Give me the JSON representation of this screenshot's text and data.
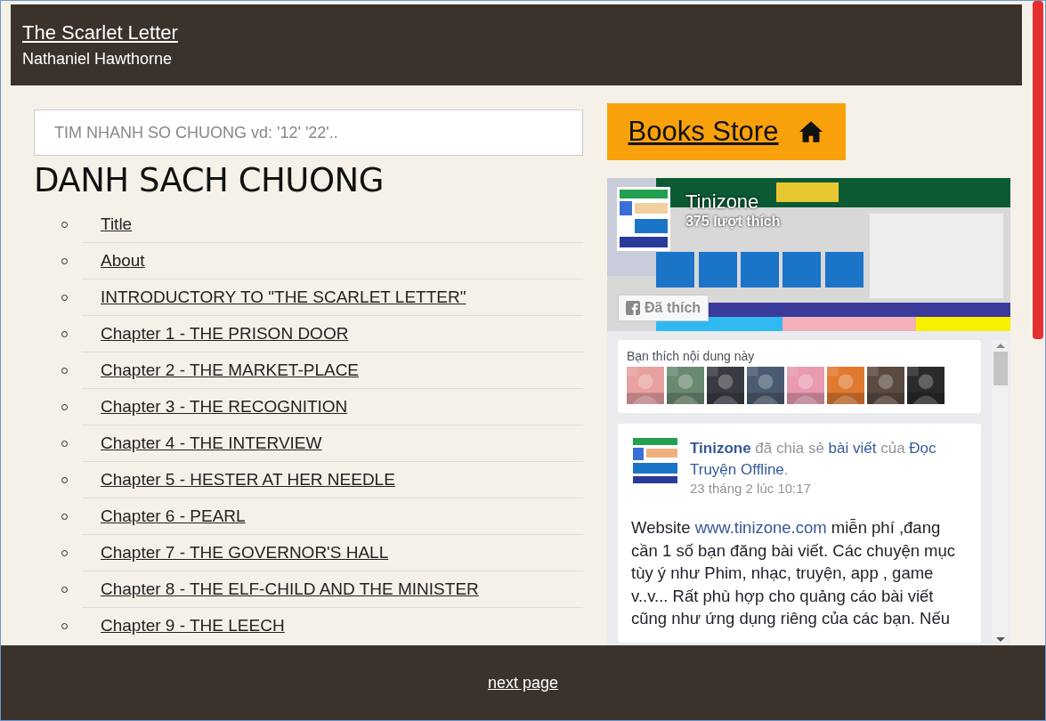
{
  "header": {
    "title": "The Scarlet Letter",
    "author": "Nathaniel Hawthorne"
  },
  "search": {
    "placeholder": "TIM NHANH SO CHUONG vd: '12' '22'.."
  },
  "heading": "DANH SACH CHUONG",
  "chapters": [
    "Title",
    "About",
    "INTRODUCTORY TO \"THE SCARLET LETTER\"",
    "Chapter 1 - THE PRISON DOOR",
    "Chapter 2 - THE MARKET-PLACE",
    "Chapter 3 - THE RECOGNITION",
    "Chapter 4 - THE INTERVIEW",
    "Chapter 5 - HESTER AT HER NEEDLE",
    "Chapter 6 - PEARL",
    "Chapter 7 - THE GOVERNOR'S HALL",
    "Chapter 8 - THE ELF-CHILD AND THE MINISTER",
    "Chapter 9 - THE LEECH"
  ],
  "store_button": {
    "label": "Books Store"
  },
  "facebook": {
    "page_name": "Tinizone",
    "likes": "375 lượt thích",
    "like_button": "Đã thích",
    "liked": true,
    "friends_title": "Bạn thích nội dung này",
    "friend_avatars": [
      {
        "color": "#e8a0a0"
      },
      {
        "color": "#6a8a70"
      },
      {
        "color": "#3a3a44"
      },
      {
        "color": "#4a5a70"
      },
      {
        "color": "#e89ab0"
      },
      {
        "color": "#e07a30"
      },
      {
        "color": "#5a4a40"
      },
      {
        "color": "#2a2a2a"
      }
    ],
    "post": {
      "author": "Tinizone",
      "shared": "đã chia sẻ",
      "link": "bài viết",
      "of": "của",
      "source": "Đọc Truyện Offline",
      "end": ".",
      "time": "23 tháng 2 lúc 10:17",
      "body_start": "Website",
      "url": "www.tinizone.com",
      "body_end": "miễn phí ,đang cần 1 số bạn đăng bài viết. Các chuyện mục tùy ý như Phim, nhạc, truyện, app , game v..v... Rất phù hợp cho quảng cáo bài viết cũng như ứng dụng riêng của các bạn. Nếu"
    }
  },
  "footer": {
    "link": "next page"
  }
}
